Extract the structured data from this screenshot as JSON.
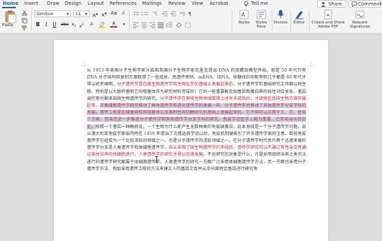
{
  "tabs": [
    {
      "label": "Home",
      "active": true
    },
    {
      "label": "Insert"
    },
    {
      "label": "Draw"
    },
    {
      "label": "Design"
    },
    {
      "label": "Layout"
    },
    {
      "label": "References"
    },
    {
      "label": "Mailings"
    },
    {
      "label": "Review"
    },
    {
      "label": "View"
    },
    {
      "label": "Acrobat"
    }
  ],
  "tell_me": "Tell me",
  "share_label": "Share",
  "comments_label": "Comments",
  "ribbon": {
    "paste_label": "Paste",
    "font_name": "SimSun",
    "font_size": "11",
    "bold": "B",
    "italic": "I",
    "underline": "U",
    "styles_label": "Styles",
    "styles_pane_label": "Styles Pane",
    "dictate_label": "Dictate",
    "editor_label": "Editor",
    "create_pdf_label": "Create and Share Adobe PDF",
    "request_sig_label": "Request Signatures"
  },
  "document": {
    "p1": "从 1953 年美国分子生物学家沃森和英国分子生物学家克里克提出 DNA 的双螺旋模型开始，但是 50 年代只有 DNA 分子结构和复制方面取得了一些成就，而遗传密码、mRNA、tRNA、核糖体的功能等则几乎都是 60 年代才得以初步阐明。",
    "r1": "分子遗传学是在微生物遗传学和生物化学的基础上发展起来的",
    "p2": "。分子遗传学的基础研究工作都以微生物，特别是以大肠杆菌和它的噬菌体作为研究材料完成的；它的一些重要概念如基因和蛋白质的线性对应关系、基因调控等也都来自微生物遗传学的研究。",
    "r2": "分子遗传学在原核生物领域取得上述许多成就后，才逐渐在真核生物方面开展起来",
    "p3": "。",
    "sel1": "正像细胞遗传学研究推动了群体遗传学和进化遗传学的发展一样，分子遗传学也推动了其他遗传学分支学科的发展。遗传工程是在细菌质粒和噬菌体以及限制性内切酶研究的基础上发展起来的，它不但可以应用于工、农、医各个方面，而且还进一步推进分子遗传学和其他遗传学分支学科的研究。免疫学在医学上极为重要，已有相当长的历史",
    "sel2": "。",
    "p4": "按照一个基因一种酶假说，一个生物为什么能产生无数种类的免疫球蛋白，这本身就是一个分子遗传学问题。自从澳大利亚免疫学家伯内特在 1959 年提出了克隆选择学说以后，免疫机制便吸引了许多遗传学家的注意。目前免疫遗传学已经成为一个比较活跃的领域之一，也是分子遗传学的活跃领域之一。在分子遗传学时代另外两个迅速发展的遗传学分支是人类遗传学和体细胞遗传学。",
    "r3": "自从采用了微生物遗传学的手段后，遗传学研究可以不通过有性杂交而通过离体培养的体细胞进行，人类遗传学的研究才得以迅速发展",
    "p5": "。不论研究的对象是什么，凡是采用组织培养之类方法进行的遗传学研究都属于体细胞遗传学。人类遗传学的研究一方面广泛采用体细胞遗传学方法，另一方面也采用分子遗传学方法，例如采用遗传工程的方法来建立人的基因文库并从中分离特定基因进行研究等"
  },
  "colors": {
    "accent": "#1f5ea8",
    "red_text": "#d4243a",
    "selection": "#c7d4ea"
  }
}
